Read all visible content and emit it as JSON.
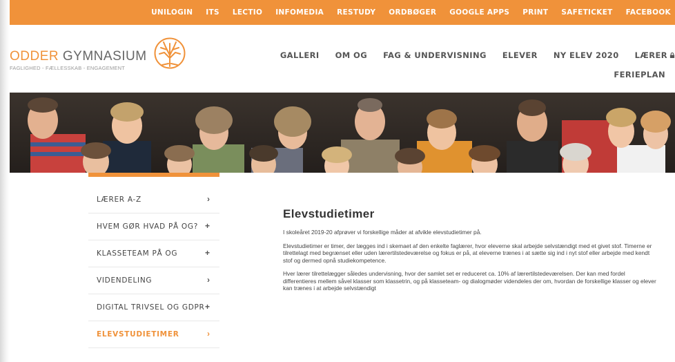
{
  "topnav": [
    "UNILOGIN",
    "ITS",
    "LECTIO",
    "INFOMEDIA",
    "RESTUDY",
    "ORDBØGER",
    "GOOGLE APPS",
    "PRINT",
    "SAFETICKET",
    "FACEBOOK"
  ],
  "logo": {
    "name_part1": "ODDER",
    "name_part2": "GYMNASIUM",
    "tagline": "FAGLIGHED - FÆLLESSKAB - ENGAGEMENT"
  },
  "mainnav": [
    "GALLERI",
    "OM OG",
    "FAG & UNDERVISNING",
    "ELEVER",
    "NY ELEV 2020",
    "LÆRER"
  ],
  "mainnav_row2": "FERIEPLAN",
  "sidebar": [
    {
      "label": "LÆRER A-Z",
      "indicator": "›"
    },
    {
      "label": "HVEM GØR HVAD PÅ OG?",
      "indicator": "+"
    },
    {
      "label": "KLASSETEAM PÅ OG",
      "indicator": "+"
    },
    {
      "label": "VIDENDELING",
      "indicator": "›"
    },
    {
      "label": "DIGITAL TRIVSEL OG GDPR",
      "indicator": "+"
    },
    {
      "label": "ELEVSTUDIETIMER",
      "indicator": "›",
      "active": true
    }
  ],
  "content": {
    "title": "Elevstudietimer",
    "paragraphs": [
      "I skoleåret 2019-20 afprøver vi forskellige måder at afvikle elevstudietimer på.",
      "Elevstudietimer er timer, der lægges ind i skemaet af den enkelte faglærer, hvor eleverne skal arbejde selvstændigt med et givet stof. Timerne er tilrettelagt med begrænset eller uden lærertilstedeværelse og fokus er på, at eleverne trænes i at sætte sig ind i nyt stof eller arbejde med kendt stof og dermed opnå studiekompetence.",
      "Hver lærer tilrettelægger således undervisning, hvor der samlet set er reduceret ca. 10% af lærertilstedeværelsen. Der kan med fordel differentieres mellem såvel klasser som klassetrin, og på klasseteam- og dialogmøder videndeles der om, hvordan de forskellige klasser og elever kan trænes i at arbejde selvstændigt"
    ]
  },
  "colors": {
    "accent": "#f0923a",
    "text": "#333333"
  },
  "icons": [
    "tree-logo-icon",
    "lock-icon",
    "chevron-right-icon",
    "plus-icon"
  ]
}
